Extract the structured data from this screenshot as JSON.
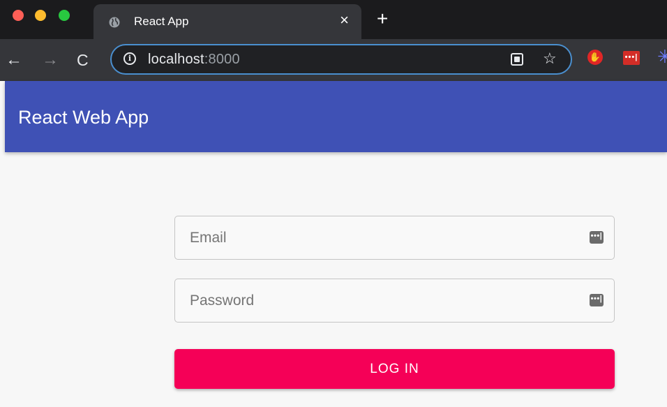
{
  "browser": {
    "tab": {
      "title": "React App",
      "close_label": "×"
    },
    "new_tab_label": "+",
    "nav": {
      "back": "←",
      "forward": "→",
      "reload": "C"
    },
    "address": {
      "host": "localhost",
      "port": ":8000",
      "info_glyph": "i"
    },
    "star_glyph": "☆",
    "extensions": {
      "hand_glyph": "✋",
      "lastpass_glyph": "•••|",
      "spark_glyph": "✳"
    }
  },
  "app": {
    "title": "React Web App",
    "brand_color": "#3f51b5",
    "accent_color": "#f50057"
  },
  "login": {
    "email": {
      "placeholder": "Email",
      "value": ""
    },
    "password": {
      "placeholder": "Password",
      "value": ""
    },
    "field_icon_glyph": "•••|",
    "button_label": "LOG IN"
  }
}
